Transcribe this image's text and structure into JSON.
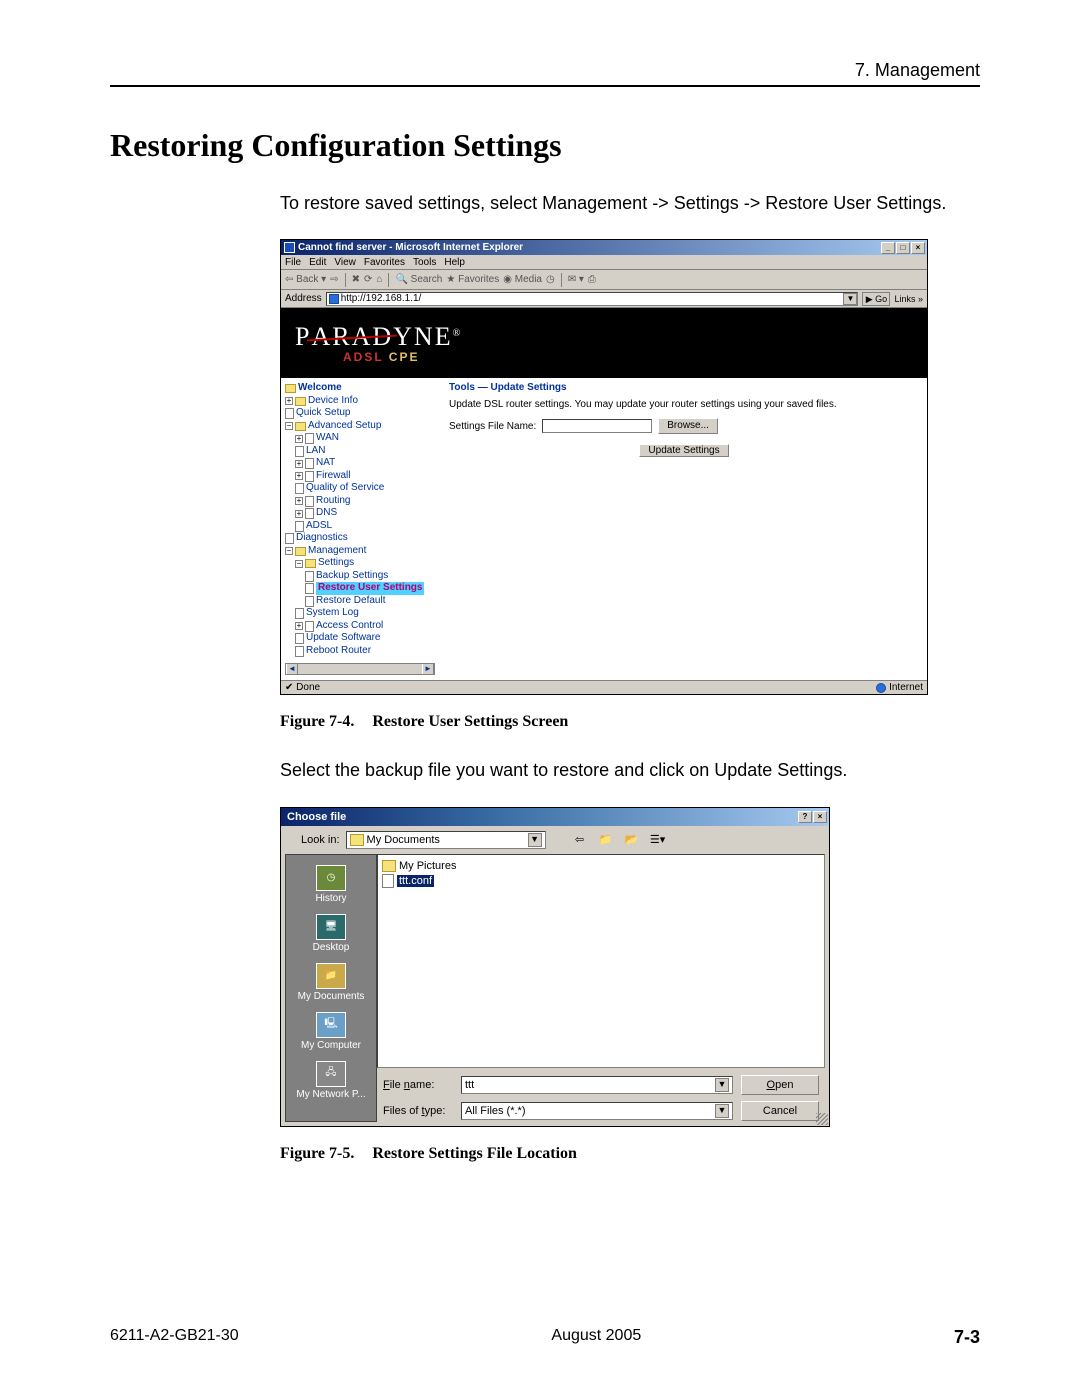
{
  "header": {
    "chapter": "7. Management"
  },
  "title": "Restoring Configuration Settings",
  "intro": "To restore saved settings, select Management -> Settings -> Restore User Settings.",
  "fig1": {
    "window_title": "Cannot find server - Microsoft Internet Explorer",
    "menus": [
      "File",
      "Edit",
      "View",
      "Favorites",
      "Tools",
      "Help"
    ],
    "toolbar": {
      "back": "Back",
      "search": "Search",
      "favorites": "Favorites",
      "media": "Media"
    },
    "address_label": "Address",
    "address_value": "http://192.168.1.1/",
    "go_label": "Go",
    "links_label": "Links »",
    "brand": "PARADYNE",
    "brand_sub_a": "ADSL",
    "brand_sub_b": "CPE",
    "tree": {
      "welcome": "Welcome",
      "device_info": "Device Info",
      "quick_setup": "Quick Setup",
      "advanced_setup": "Advanced Setup",
      "wan": "WAN",
      "lan": "LAN",
      "nat": "NAT",
      "firewall": "Firewall",
      "qos": "Quality of Service",
      "routing": "Routing",
      "dns": "DNS",
      "adsl": "ADSL",
      "diagnostics": "Diagnostics",
      "management": "Management",
      "settings": "Settings",
      "backup": "Backup Settings",
      "restore_user": "Restore User Settings",
      "restore_default": "Restore Default",
      "syslog": "System Log",
      "access": "Access Control",
      "update_sw": "Update Software",
      "reboot": "Reboot Router"
    },
    "main": {
      "crumb": "Tools — Update Settings",
      "desc": "Update DSL router settings. You may update your router settings using your saved files.",
      "file_label": "Settings File Name:",
      "browse": "Browse...",
      "update": "Update Settings"
    },
    "status_done": "Done",
    "status_zone": "Internet"
  },
  "fig1_caption_a": "Figure 7-4.",
  "fig1_caption_b": "Restore User Settings Screen",
  "mid_text": "Select the backup file you want to restore and click on Update Settings.",
  "fig2": {
    "title": "Choose file",
    "lookin_label": "Look in:",
    "lookin_value": "My Documents",
    "places": [
      "History",
      "Desktop",
      "My Documents",
      "My Computer",
      "My Network P..."
    ],
    "list": [
      {
        "icon": "folder",
        "name": "My Pictures",
        "selected": false
      },
      {
        "icon": "doc",
        "name": "ttt.conf",
        "selected": true
      }
    ],
    "filename_label": "File name:",
    "filename_value": "ttt",
    "filetype_label": "Files of type:",
    "filetype_value": "All Files (*.*)",
    "open": "Open",
    "cancel": "Cancel"
  },
  "fig2_caption_a": "Figure 7-5.",
  "fig2_caption_b": "Restore Settings File Location",
  "footer": {
    "left": "6211-A2-GB21-30",
    "center": "August 2005",
    "right": "7-3"
  }
}
